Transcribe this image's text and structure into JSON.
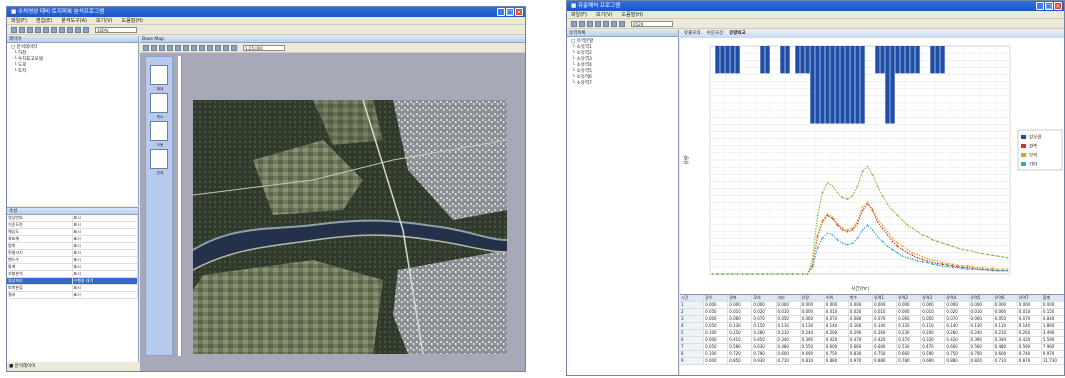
{
  "left_window": {
    "title": "■ 수치영상 대비 토지피복 분석프로그램",
    "menu": [
      "파일(F)",
      "편집(E)",
      "분석도구(A)",
      "보기(V)",
      "도움말(H)"
    ],
    "zoom": "100%",
    "layers_header": "레이어",
    "layers": [
      "□ 분석데이터",
      "  └ 하천",
      "  └ 수치표고모델",
      "  └ 도로",
      "  └ 토지"
    ],
    "map_tab": "Base Map",
    "map_scale": "1:25,000",
    "side_tools": [
      "확대",
      "축소",
      "이동",
      "전체"
    ],
    "props_header": "속성",
    "props": [
      [
        "영상번호",
        "표시"
      ],
      [
        "기준도면",
        "표시"
      ],
      [
        "해상도",
        "표시"
      ],
      [
        "좌표계",
        "표시"
      ],
      [
        "범위",
        "표시"
      ],
      [
        "픽셀크기",
        "표시"
      ],
      [
        "밴드수",
        "표시"
      ],
      [
        "통계",
        "표시"
      ],
      [
        "지형분석",
        "표시"
      ],
      [
        "영상처리",
        "수행중 대기"
      ],
      [
        "피복분류",
        "표시"
      ],
      [
        "결과",
        "표시"
      ]
    ],
    "status": "■ 분석레이어"
  },
  "right_window": {
    "title": "■ 유출해석 프로그램",
    "menu": [
      "파일(F)",
      "보기(V)",
      "도움말(H)"
    ],
    "combo": "0520",
    "panel_header": "유역목록",
    "tree": [
      "□ 유역분할",
      " └ 소유역1",
      " └ 소유역2",
      " └ 소유역3",
      " └ 소유역4",
      " └ 소유역5",
      " └ 소유역6",
      " └ 소유역7"
    ],
    "tabs": [
      "유출모의",
      "수문곡선",
      "유량비교"
    ],
    "legend": [
      {
        "name": "강우량",
        "color": "#1f4ea8"
      },
      {
        "name": "관측",
        "color": "#c0392b"
      },
      {
        "name": "모의",
        "color": "#e0a020"
      },
      {
        "name": "기타",
        "color": "#3aa0d8"
      }
    ],
    "xlabel": "시간(hr)",
    "ylabel": "유량"
  },
  "chart_data": {
    "type": "line",
    "rain": [
      0,
      1,
      1,
      1,
      1,
      1,
      0,
      0,
      0,
      0,
      1,
      1,
      0,
      0,
      1,
      1,
      0,
      1,
      1,
      1,
      2,
      2,
      2,
      2,
      2,
      2,
      2,
      2,
      2,
      2,
      2,
      0,
      0,
      1,
      1,
      2,
      2,
      1,
      1,
      1,
      1,
      1,
      0,
      0,
      1,
      1,
      1,
      0,
      0,
      0,
      0,
      0,
      0,
      0,
      0,
      0,
      0,
      0,
      0,
      0
    ],
    "series": [
      {
        "name": "관측",
        "color": "#c0392b",
        "values": [
          0,
          0,
          0,
          0,
          0,
          0,
          0,
          0,
          0,
          0,
          0,
          0,
          0,
          0,
          0,
          0,
          0,
          0,
          0,
          0,
          0.5,
          2.3,
          3.2,
          3.6,
          3.4,
          3.0,
          2.7,
          2.6,
          2.7,
          3.1,
          3.9,
          4.3,
          3.9,
          3.2,
          2.8,
          2.4,
          2.0,
          1.7,
          1.5,
          1.3,
          1.15,
          1.0,
          0.9,
          0.8,
          0.7,
          0.65,
          0.6,
          0.55,
          0.5,
          0.45,
          0.4,
          0.4,
          0.35,
          0.3,
          0.3,
          0.25,
          0.25,
          0.2,
          0.2,
          0.2
        ]
      },
      {
        "name": "모의",
        "color": "#e0a020",
        "values": [
          0,
          0,
          0,
          0,
          0,
          0,
          0,
          0,
          0,
          0,
          0,
          0,
          0,
          0,
          0,
          0,
          0,
          0,
          0,
          0,
          0.6,
          2.4,
          3.3,
          3.7,
          3.5,
          3.1,
          2.8,
          2.7,
          2.8,
          3.3,
          4.1,
          4.4,
          4.0,
          3.4,
          3.0,
          2.6,
          2.2,
          1.9,
          1.7,
          1.5,
          1.3,
          1.2,
          1.05,
          0.95,
          0.85,
          0.8,
          0.7,
          0.65,
          0.6,
          0.55,
          0.5,
          0.5,
          0.45,
          0.4,
          0.4,
          0.35,
          0.35,
          0.3,
          0.3,
          0.3
        ]
      },
      {
        "name": "기타",
        "color": "#3aa0d8",
        "values": [
          0,
          0,
          0,
          0,
          0,
          0,
          0,
          0,
          0,
          0,
          0,
          0,
          0,
          0,
          0,
          0,
          0,
          0,
          0,
          0,
          0.4,
          1.6,
          2.2,
          2.5,
          2.4,
          2.1,
          1.9,
          1.8,
          1.9,
          2.2,
          2.7,
          3.0,
          2.7,
          2.3,
          2.0,
          1.7,
          1.5,
          1.3,
          1.1,
          1.0,
          0.9,
          0.8,
          0.75,
          0.7,
          0.6,
          0.55,
          0.5,
          0.45,
          0.4,
          0.4,
          0.35,
          0.3,
          0.3,
          0.3,
          0.25,
          0.25,
          0.2,
          0.2,
          0.2,
          0.2
        ]
      },
      {
        "name": "강우량",
        "color": "#7bb93a",
        "values": [
          0,
          0,
          0,
          0,
          0,
          0,
          0,
          0,
          0,
          0,
          0,
          0,
          0,
          0,
          0,
          0,
          0,
          0,
          0,
          0,
          0.9,
          3.6,
          5.0,
          5.6,
          5.4,
          5.0,
          4.7,
          4.6,
          4.8,
          5.4,
          6.3,
          6.6,
          6.1,
          5.4,
          4.8,
          4.3,
          3.9,
          3.6,
          3.3,
          3.0,
          2.8,
          2.6,
          2.4,
          2.3,
          2.1,
          2.0,
          1.9,
          1.8,
          1.7,
          1.6,
          1.5,
          1.45,
          1.4,
          1.3,
          1.25,
          1.2,
          1.15,
          1.1,
          1.05,
          1.0
        ]
      }
    ]
  },
  "table": {
    "headers": [
      "시간",
      "강우",
      "관측",
      "모의",
      "기타",
      "유량",
      "수위",
      "변수",
      "유역1",
      "유역2",
      "유역3",
      "유역4",
      "유역5",
      "유역6",
      "유역7",
      "합계"
    ],
    "rows": [
      [
        "1",
        "0.000",
        "0.000",
        "0.000",
        "0.000",
        "0.000",
        "0.000",
        "0.000",
        "0.000",
        "0.000",
        "0.000",
        "0.000",
        "0.000",
        "0.000",
        "0.000",
        "0.000"
      ],
      [
        "2",
        "0.050",
        "0.010",
        "0.020",
        "0.010",
        "0.000",
        "0.010",
        "0.020",
        "0.010",
        "0.000",
        "0.010",
        "0.020",
        "0.010",
        "0.000",
        "0.010",
        "0.150"
      ],
      [
        "3",
        "0.000",
        "0.060",
        "0.070",
        "0.050",
        "0.060",
        "0.070",
        "0.080",
        "0.070",
        "0.060",
        "0.050",
        "0.070",
        "0.060",
        "0.050",
        "0.070",
        "0.840"
      ],
      [
        "4",
        "0.050",
        "0.130",
        "0.150",
        "0.110",
        "0.130",
        "0.140",
        "0.160",
        "0.140",
        "0.120",
        "0.110",
        "0.140",
        "0.130",
        "0.110",
        "0.140",
        "1.860"
      ],
      [
        "5",
        "0.100",
        "0.250",
        "0.280",
        "0.210",
        "0.240",
        "0.260",
        "0.290",
        "0.260",
        "0.230",
        "0.200",
        "0.260",
        "0.240",
        "0.210",
        "0.260",
        "3.490"
      ],
      [
        "6",
        "0.000",
        "0.410",
        "0.450",
        "0.340",
        "0.390",
        "0.420",
        "0.470",
        "0.420",
        "0.370",
        "0.330",
        "0.420",
        "0.390",
        "0.340",
        "0.420",
        "5.590"
      ],
      [
        "7",
        "0.050",
        "0.580",
        "0.630",
        "0.480",
        "0.550",
        "0.600",
        "0.660",
        "0.600",
        "0.530",
        "0.470",
        "0.600",
        "0.560",
        "0.480",
        "0.590",
        "7.960"
      ],
      [
        "8",
        "0.100",
        "0.720",
        "0.790",
        "0.600",
        "0.690",
        "0.750",
        "0.830",
        "0.750",
        "0.660",
        "0.590",
        "0.750",
        "0.700",
        "0.600",
        "0.740",
        "9.970"
      ],
      [
        "9",
        "0.000",
        "0.850",
        "0.930",
        "0.710",
        "0.810",
        "0.880",
        "0.970",
        "0.880",
        "0.780",
        "0.690",
        "0.880",
        "0.820",
        "0.710",
        "0.870",
        "11.730"
      ]
    ]
  }
}
